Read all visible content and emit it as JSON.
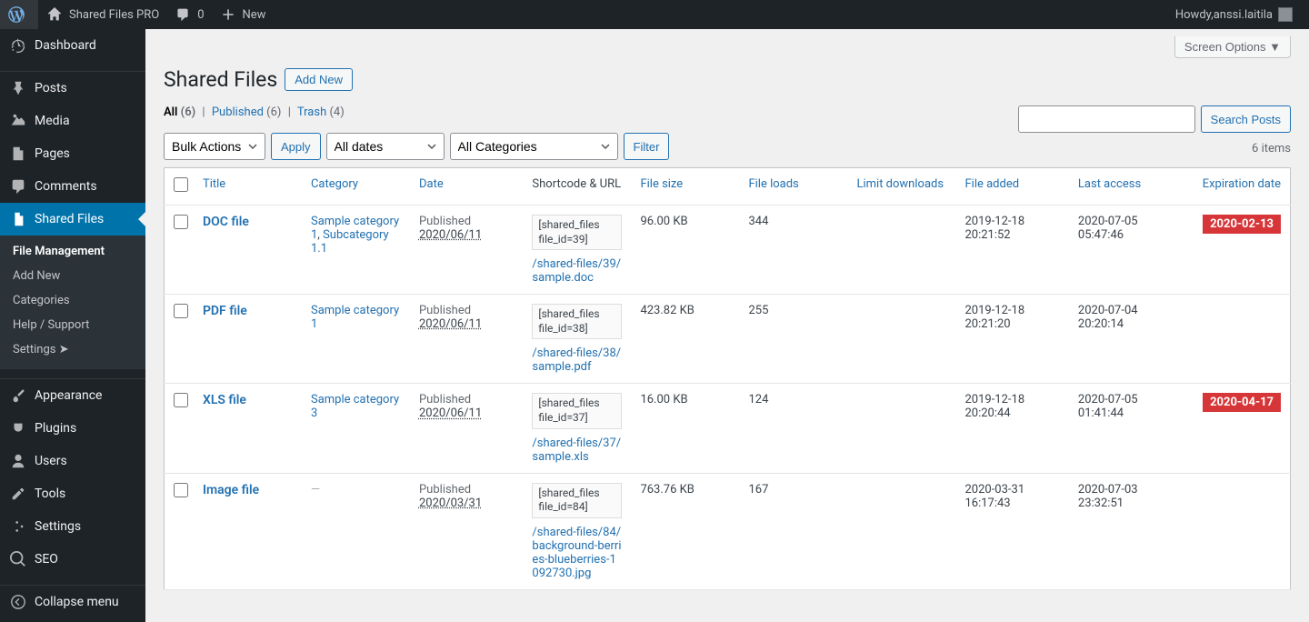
{
  "adminbar": {
    "site_title": "Shared Files PRO",
    "comments_count": "0",
    "new_label": "New",
    "howdy_prefix": "Howdy, ",
    "username": "anssi.laitila"
  },
  "sidebar": {
    "items": [
      {
        "label": "Dashboard"
      },
      {
        "label": "Posts"
      },
      {
        "label": "Media"
      },
      {
        "label": "Pages"
      },
      {
        "label": "Comments"
      },
      {
        "label": "Shared Files"
      },
      {
        "label": "Appearance"
      },
      {
        "label": "Plugins"
      },
      {
        "label": "Users"
      },
      {
        "label": "Tools"
      },
      {
        "label": "Settings"
      },
      {
        "label": "SEO"
      },
      {
        "label": "Collapse menu"
      }
    ],
    "submenu": [
      {
        "label": "File Management"
      },
      {
        "label": "Add New"
      },
      {
        "label": "Categories"
      },
      {
        "label": "Help / Support"
      },
      {
        "label": "Settings  ➤"
      }
    ]
  },
  "header": {
    "screen_options": "Screen Options ▼",
    "page_title": "Shared Files",
    "add_new": "Add New"
  },
  "filters": {
    "all_label": "All",
    "all_count": "(6)",
    "published_label": "Published",
    "published_count": "(6)",
    "trash_label": "Trash",
    "trash_count": "(4)"
  },
  "actions": {
    "bulk_actions": "Bulk Actions",
    "apply": "Apply",
    "all_dates": "All dates",
    "all_categories": "All Categories",
    "filter": "Filter",
    "search_posts": "Search Posts",
    "items_count": "6 items"
  },
  "columns": {
    "title": "Title",
    "category": "Category",
    "date": "Date",
    "shortcode": "Shortcode & URL",
    "file_size": "File size",
    "file_loads": "File loads",
    "limit_downloads": "Limit downloads",
    "file_added": "File added",
    "last_access": "Last access",
    "expiration_date": "Expiration date"
  },
  "rows": [
    {
      "title": "DOC file",
      "categories": "Sample category 1, Subcategory 1.1",
      "date_label": "Published",
      "date": "2020/06/11",
      "shortcode": "[shared_files file_id=39]",
      "url": "/shared-files/39/sample.doc",
      "file_size": "96.00 KB",
      "file_loads": "344",
      "limit_downloads": "",
      "file_added": "2019-12-18 20:21:52",
      "last_access": "2020-07-05 05:47:46",
      "expiration": "2020-02-13"
    },
    {
      "title": "PDF file",
      "categories": "Sample category 1",
      "date_label": "Published",
      "date": "2020/06/11",
      "shortcode": "[shared_files file_id=38]",
      "url": "/shared-files/38/sample.pdf",
      "file_size": "423.82 KB",
      "file_loads": "255",
      "limit_downloads": "",
      "file_added": "2019-12-18 20:21:20",
      "last_access": "2020-07-04 20:20:14",
      "expiration": ""
    },
    {
      "title": "XLS file",
      "categories": "Sample category 3",
      "date_label": "Published",
      "date": "2020/06/11",
      "shortcode": "[shared_files file_id=37]",
      "url": "/shared-files/37/sample.xls",
      "file_size": "16.00 KB",
      "file_loads": "124",
      "limit_downloads": "",
      "file_added": "2019-12-18 20:20:44",
      "last_access": "2020-07-05 01:41:44",
      "expiration": "2020-04-17"
    },
    {
      "title": "Image file",
      "categories": "—",
      "date_label": "Published",
      "date": "2020/03/31",
      "shortcode": "[shared_files file_id=84]",
      "url": "/shared-files/84/background-berries-blueberries-1092730.jpg",
      "file_size": "763.76 KB",
      "file_loads": "167",
      "limit_downloads": "",
      "file_added": "2020-03-31 16:17:43",
      "last_access": "2020-07-03 23:32:51",
      "expiration": ""
    }
  ]
}
